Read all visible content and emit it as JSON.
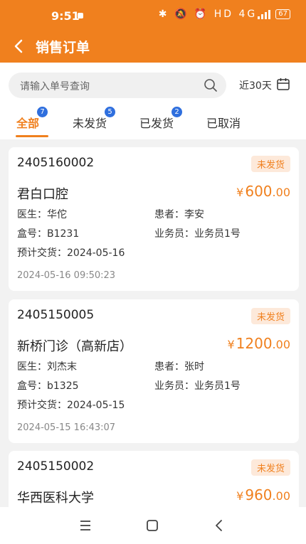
{
  "status_bar": {
    "time": "9:51",
    "icons": "✱ 🔕 ⏰ HD 4G",
    "battery": "67"
  },
  "header": {
    "title": "销售订单"
  },
  "search": {
    "placeholder": "请输入单号查询",
    "date_range": "近30天"
  },
  "tabs": [
    {
      "label": "全部",
      "badge": "7"
    },
    {
      "label": "未发货",
      "badge": "5"
    },
    {
      "label": "已发货",
      "badge": "2"
    },
    {
      "label": "已取消"
    }
  ],
  "labels": {
    "doctor": "医生：",
    "patient": "患者：",
    "box": "盒号：",
    "sales": "业务员：",
    "delivery": "预计交货：",
    "yen": "¥"
  },
  "orders": [
    {
      "order_no": "2405160002",
      "status": "未发货",
      "customer": "君白口腔",
      "amount_int": "600",
      "amount_dec": ".00",
      "doctor": "华佗",
      "patient": "李安",
      "box_no": "B1231",
      "salesperson": "业务员1号",
      "delivery_date": "2024-05-16",
      "created_at": "2024-05-16 09:50:23"
    },
    {
      "order_no": "2405150005",
      "status": "未发货",
      "customer": "新桥门诊（高新店）",
      "amount_int": "1200",
      "amount_dec": ".00",
      "doctor": "刘杰末",
      "patient": "张时",
      "box_no": "b1325",
      "salesperson": "业务员1号",
      "delivery_date": "2024-05-15",
      "created_at": "2024-05-15 16:43:07"
    },
    {
      "order_no": "2405150002",
      "status": "未发货",
      "customer": "华西医科大学",
      "amount_int": "960",
      "amount_dec": ".00"
    }
  ]
}
